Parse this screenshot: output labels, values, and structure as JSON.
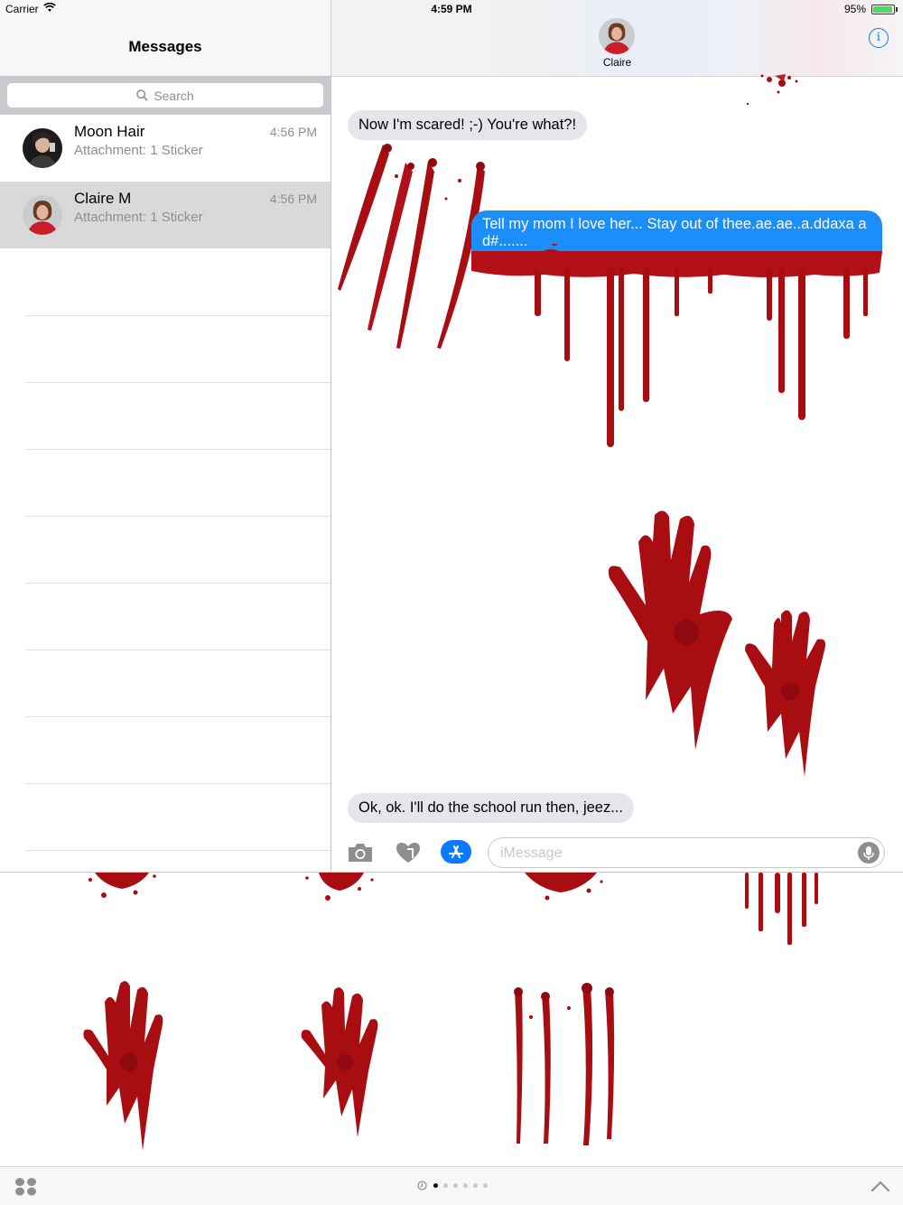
{
  "status_bar": {
    "carrier": "Carrier",
    "time": "4:59 PM",
    "battery": "95%"
  },
  "sidebar": {
    "title": "Messages",
    "search_placeholder": "Search",
    "conversations": [
      {
        "name": "Moon Hair",
        "preview": "Attachment: 1 Sticker",
        "time": "4:56 PM",
        "selected": false
      },
      {
        "name": "Claire M",
        "preview": "Attachment: 1 Sticker",
        "time": "4:56 PM",
        "selected": true
      }
    ]
  },
  "chat": {
    "contact_name": "Claire",
    "messages": [
      {
        "direction": "incoming",
        "text": "Now I'm scared! ;-) You're what?!"
      },
      {
        "direction": "outgoing",
        "text": "Tell my mom I love her... Stay out of thee.ae.ae..a.ddaxa a d#......."
      },
      {
        "direction": "incoming",
        "text": "Ok, ok. I'll do the school run then, jeez..."
      }
    ],
    "input_placeholder": "iMessage"
  },
  "drawer": {
    "page_count": 6,
    "active_page": 0
  },
  "colors": {
    "ios_blue": "#0a7aff",
    "outgoing_bubble": "#1c8ef9",
    "incoming_bubble": "#e6e5eb",
    "blood": "#a80d12",
    "selected_row": "#d9d9d9"
  }
}
